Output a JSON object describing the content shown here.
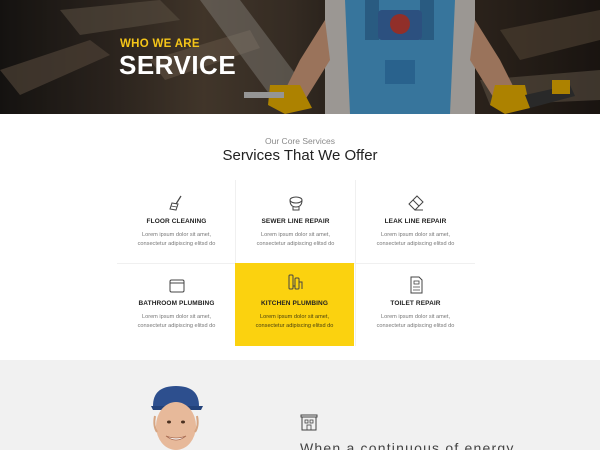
{
  "hero": {
    "eyebrow": "WHO WE ARE",
    "title": "SERVICE"
  },
  "services_section": {
    "eyebrow": "Our Core Services",
    "title": "Services That We Offer",
    "items": [
      {
        "title": "FLOOR CLEANING",
        "line1": "Lorem ipsum dolor sit amet,",
        "line2": "consectetur adipiscing elitsd do",
        "icon": "broom-icon",
        "active": false
      },
      {
        "title": "SEWER LINE REPAIR",
        "line1": "Lorem ipsum dolor sit amet,",
        "line2": "consectetur adipiscing elitsd do",
        "icon": "toilet-icon",
        "active": false
      },
      {
        "title": "LEAK LINE REPAIR",
        "line1": "Lorem ipsum dolor sit amet,",
        "line2": "consectetur adipiscing elitsd do",
        "icon": "eraser-icon",
        "active": false
      },
      {
        "title": "BATHROOM PLUMBING",
        "line1": "Lorem ipsum dolor sit amet,",
        "line2": "consectetur adipiscing elitsd do",
        "icon": "window-icon",
        "active": false
      },
      {
        "title": "KITCHEN PLUMBING",
        "line1": "Lorem ipsum dolor sit amet,",
        "line2": "consectetur adipiscing elitsd do",
        "icon": "pipes-icon",
        "active": true
      },
      {
        "title": "TOILET REPAIR",
        "line1": "Lorem ipsum dolor sit amet,",
        "line2": "consectetur adipiscing elitsd do",
        "icon": "document-icon",
        "active": false
      }
    ]
  },
  "bottom": {
    "text": "When a continuous of energy",
    "icon": "building-icon"
  },
  "colors": {
    "accent": "#fbd20f",
    "hero_eyebrow": "#f5c518",
    "bottom_bg": "#f1f1f1"
  }
}
